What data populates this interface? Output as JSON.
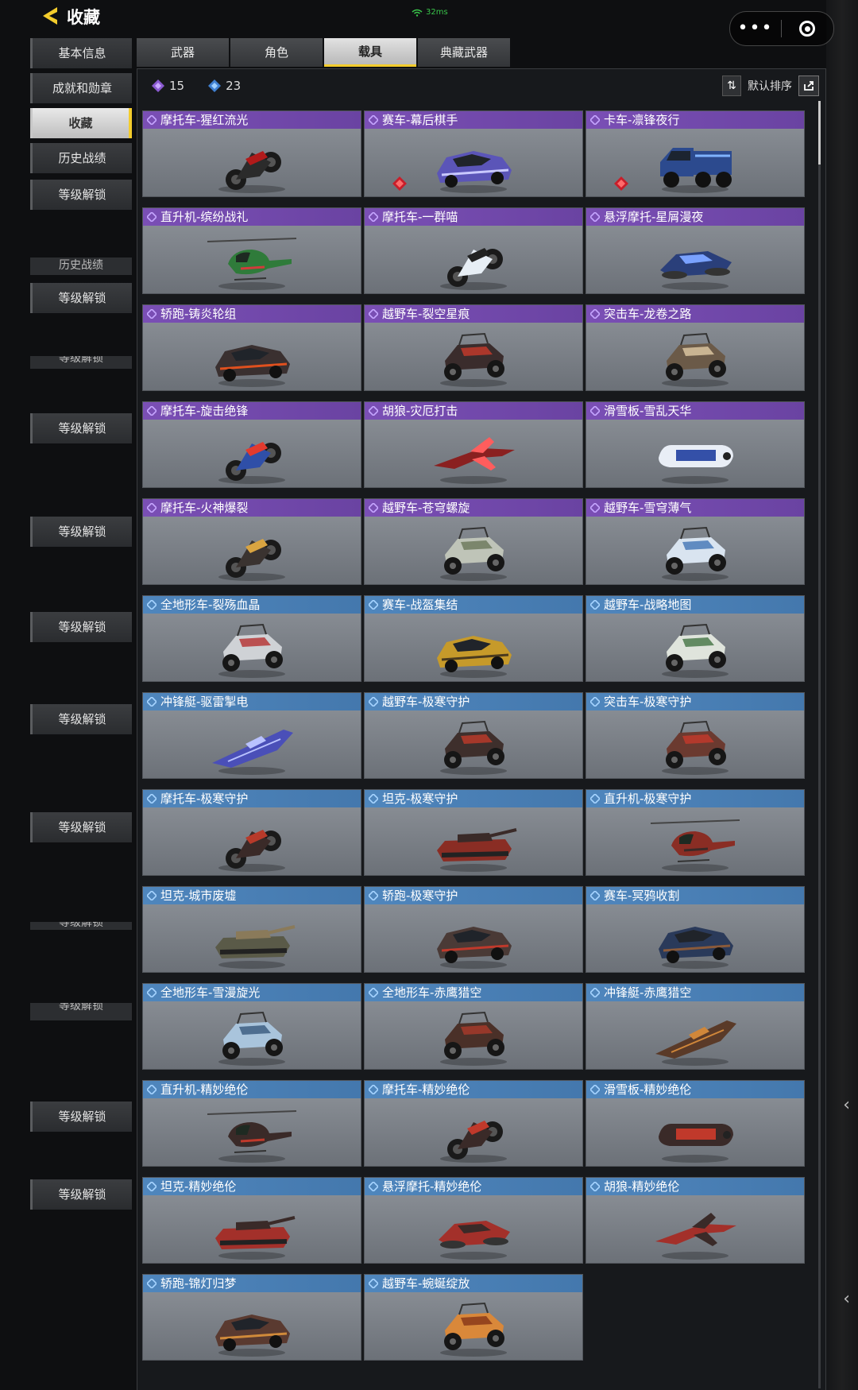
{
  "header": {
    "title": "收藏",
    "ping": "32ms",
    "more_label": "•••"
  },
  "sidebar": {
    "items": [
      {
        "label": "基本信息"
      },
      {
        "label": "成就和勋章"
      },
      {
        "label": "收藏",
        "active": true
      },
      {
        "label": "历史战绩"
      },
      {
        "label": "等级解锁"
      }
    ],
    "ghost_items": [
      {
        "label": "历史战绩"
      },
      {
        "label": "等级解锁"
      },
      {
        "label": "等级解锁"
      },
      {
        "label": "等级解锁"
      },
      {
        "label": "等级解锁"
      },
      {
        "label": "等级解锁"
      },
      {
        "label": "等级解锁"
      },
      {
        "label": "等级解锁"
      },
      {
        "label": "等级解锁"
      },
      {
        "label": "等级解锁"
      },
      {
        "label": "等级解锁"
      }
    ]
  },
  "tabs": [
    {
      "label": "武器"
    },
    {
      "label": "角色"
    },
    {
      "label": "载具",
      "active": true
    },
    {
      "label": "典藏武器"
    }
  ],
  "counts": {
    "purple": "15",
    "blue": "23"
  },
  "sort": {
    "label": "默认排序",
    "toggle_symbol": "⇅",
    "share_symbol": "↗"
  },
  "colors": {
    "accent_yellow": "#f3cc2c",
    "purple_header": "#7a4fb5",
    "blue_header": "#4f86bd"
  },
  "vehicles": [
    {
      "name": "摩托车-猩红流光",
      "tier": "purple",
      "type": "moto",
      "body": "#2b2b2b",
      "accent": "#b11a1a"
    },
    {
      "name": "赛车-幕后棋手",
      "tier": "purple",
      "type": "car",
      "body": "#5b55b8",
      "accent": "#c9c9ff",
      "badge": true
    },
    {
      "name": "卡车-凛锋夜行",
      "tier": "purple",
      "type": "truck",
      "body": "#2c4a8e",
      "accent": "#7fb3ff",
      "badge": true
    },
    {
      "name": "直升机-缤纷战礼",
      "tier": "purple",
      "type": "heli",
      "body": "#2f7b3a",
      "accent": "#d23b3b"
    },
    {
      "name": "摩托车-一群喵",
      "tier": "purple",
      "type": "moto",
      "body": "#e7eef5",
      "accent": "#222222"
    },
    {
      "name": "悬浮摩托-星屑漫夜",
      "tier": "purple",
      "type": "hover",
      "body": "#2a3f7a",
      "accent": "#7aa2ff"
    },
    {
      "name": "轿跑-铸炎轮组",
      "tier": "purple",
      "type": "car",
      "body": "#3a3030",
      "accent": "#e0501e"
    },
    {
      "name": "越野车-裂空星痕",
      "tier": "purple",
      "type": "buggy",
      "body": "#3a2c2c",
      "accent": "#c0392b"
    },
    {
      "name": "突击车-龙卷之路",
      "tier": "purple",
      "type": "buggy",
      "body": "#6b5a48",
      "accent": "#d9c4a0"
    },
    {
      "name": "摩托车-旋击绝锋",
      "tier": "purple",
      "type": "moto",
      "body": "#2f4fa8",
      "accent": "#e33a2e"
    },
    {
      "name": "胡狼-灾厄打击",
      "tier": "purple",
      "type": "jet",
      "body": "#8a2020",
      "accent": "#ff5d5d"
    },
    {
      "name": "滑雪板-雪乱天华",
      "tier": "purple",
      "type": "sled",
      "body": "#e9eef6",
      "accent": "#3450a8"
    },
    {
      "name": "摩托车-火神爆裂",
      "tier": "purple",
      "type": "moto",
      "body": "#3a3330",
      "accent": "#d9a441"
    },
    {
      "name": "越野车-苍穹螺旋",
      "tier": "purple",
      "type": "buggy",
      "body": "#bfc4b8",
      "accent": "#6f7b5e"
    },
    {
      "name": "越野车-雪穹薄气",
      "tier": "purple",
      "type": "buggy",
      "body": "#d9e4f0",
      "accent": "#4a7bb8"
    },
    {
      "name": "全地形车-裂殇血晶",
      "tier": "blue",
      "type": "atv",
      "body": "#cfd2d6",
      "accent": "#b63a3a"
    },
    {
      "name": "赛车-战盔集结",
      "tier": "blue",
      "type": "car",
      "body": "#c69a2a",
      "accent": "#4a3a1e"
    },
    {
      "name": "越野车-战略地图",
      "tier": "blue",
      "type": "buggy",
      "body": "#dfe4dc",
      "accent": "#4c7a4c"
    },
    {
      "name": "冲锋艇-驱雷掣电",
      "tier": "blue",
      "type": "boat",
      "body": "#4a4fb8",
      "accent": "#b9c2ff"
    },
    {
      "name": "越野车-极寒守护",
      "tier": "blue",
      "type": "buggy",
      "body": "#3e2f2c",
      "accent": "#b73a2a"
    },
    {
      "name": "突击车-极寒守护",
      "tier": "blue",
      "type": "buggy",
      "body": "#6b3a30",
      "accent": "#c0392b"
    },
    {
      "name": "摩托车-极寒守护",
      "tier": "blue",
      "type": "moto",
      "body": "#3a2a28",
      "accent": "#b73a2a"
    },
    {
      "name": "坦克-极寒守护",
      "tier": "blue",
      "type": "tank",
      "body": "#8a2d24",
      "accent": "#3a2a28"
    },
    {
      "name": "直升机-极寒守护",
      "tier": "blue",
      "type": "heli",
      "body": "#8a2d24",
      "accent": "#3a2a28"
    },
    {
      "name": "坦克-城市废墟",
      "tier": "blue",
      "type": "tank",
      "body": "#5a5a48",
      "accent": "#8a7a5a"
    },
    {
      "name": "轿跑-极寒守护",
      "tier": "blue",
      "type": "car",
      "body": "#4a3a36",
      "accent": "#c0392b"
    },
    {
      "name": "赛车-冥鸦收割",
      "tier": "blue",
      "type": "car",
      "body": "#2a3a5a",
      "accent": "#8a5a3a"
    },
    {
      "name": "全地形车-雪漫旋光",
      "tier": "blue",
      "type": "atv",
      "body": "#a9c4dc",
      "accent": "#3e5f82"
    },
    {
      "name": "全地形车-赤鹰猎空",
      "tier": "blue",
      "type": "buggy",
      "body": "#4a3028",
      "accent": "#a33a2a"
    },
    {
      "name": "冲锋艇-赤鹰猎空",
      "tier": "blue",
      "type": "boat",
      "body": "#5a3a28",
      "accent": "#d0873a"
    },
    {
      "name": "直升机-精妙绝伦",
      "tier": "blue",
      "type": "heli",
      "body": "#3a2a28",
      "accent": "#c0392b"
    },
    {
      "name": "摩托车-精妙绝伦",
      "tier": "blue",
      "type": "moto",
      "body": "#3a2a28",
      "accent": "#c0392b"
    },
    {
      "name": "滑雪板-精妙绝伦",
      "tier": "blue",
      "type": "sled",
      "body": "#3a2a28",
      "accent": "#c0392b"
    },
    {
      "name": "坦克-精妙绝伦",
      "tier": "blue",
      "type": "tank",
      "body": "#a3302a",
      "accent": "#3a2a28"
    },
    {
      "name": "悬浮摩托-精妙绝伦",
      "tier": "blue",
      "type": "hover",
      "body": "#a3302a",
      "accent": "#3a2a28"
    },
    {
      "name": "胡狼-精妙绝伦",
      "tier": "blue",
      "type": "jet",
      "body": "#a3302a",
      "accent": "#3a2a28"
    },
    {
      "name": "轿跑-锦灯归梦",
      "tier": "blue",
      "type": "car",
      "body": "#5a3a30",
      "accent": "#d08a3a"
    },
    {
      "name": "越野车-蜿蜒绽放",
      "tier": "blue",
      "type": "buggy",
      "body": "#d9883a",
      "accent": "#8a3a1a"
    }
  ]
}
